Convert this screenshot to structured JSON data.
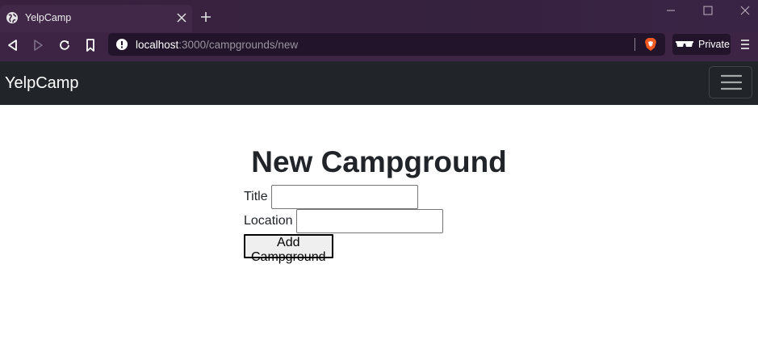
{
  "browser": {
    "tab_title": "YelpCamp",
    "url_host": "localhost",
    "url_path": ":3000/campgrounds/new",
    "private_label": "Private"
  },
  "navbar": {
    "brand": "YelpCamp"
  },
  "page": {
    "title": "New Campground",
    "form": {
      "title_label": "Title",
      "title_value": "",
      "location_label": "Location",
      "location_value": "",
      "submit_label": "Add Campground"
    }
  },
  "colors": {
    "navbar_bg": "#212529",
    "chrome_bg": "#3d2445",
    "text": "#212529"
  }
}
